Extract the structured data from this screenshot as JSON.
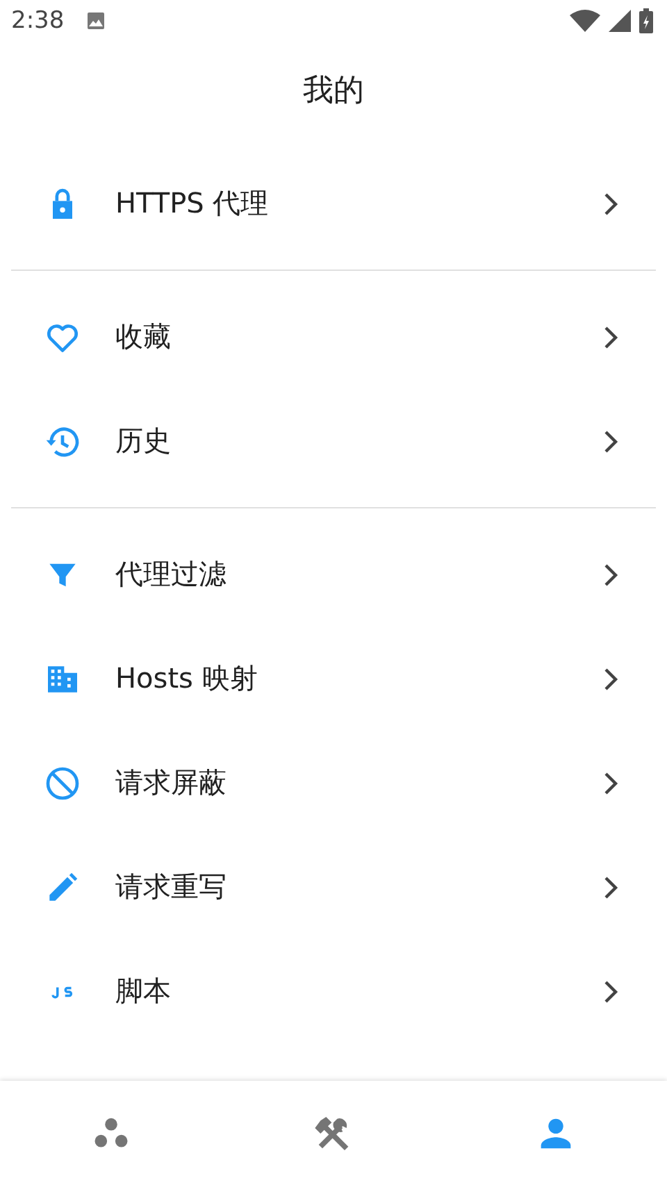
{
  "status_bar": {
    "time": "2:38"
  },
  "title": "我的",
  "sections": [
    {
      "items": [
        {
          "label": "HTTPS 代理"
        }
      ]
    },
    {
      "items": [
        {
          "label": "收藏"
        },
        {
          "label": "历史"
        }
      ]
    },
    {
      "items": [
        {
          "label": "代理过滤"
        },
        {
          "label": "Hosts 映射"
        },
        {
          "label": "请求屏蔽"
        },
        {
          "label": "请求重写"
        },
        {
          "label": "脚本"
        }
      ]
    }
  ],
  "tabs": [
    {
      "selected": false
    },
    {
      "selected": false
    },
    {
      "selected": true
    }
  ]
}
